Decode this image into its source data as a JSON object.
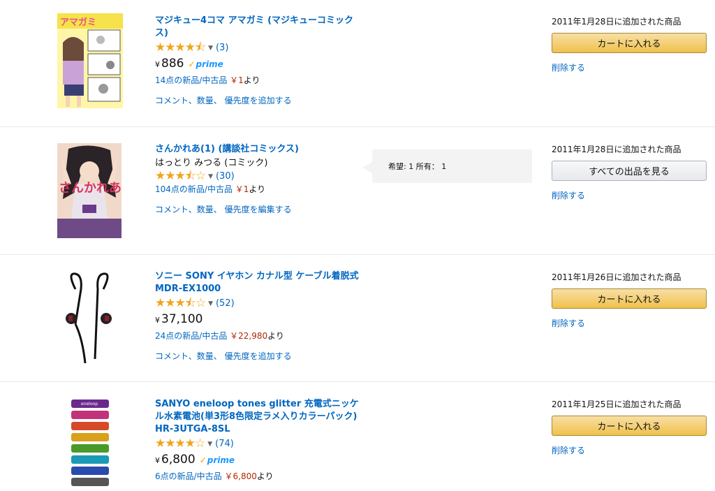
{
  "items": [
    {
      "title": "マジキュー4コマ アマガミ (マジキューコミックス)",
      "author": "",
      "stars": "★★★★⯪",
      "review_count": "(3)",
      "price": "886",
      "yen": "¥",
      "prime": "prime",
      "offers_text": "14点の新品/中古品",
      "offers_price": "￥1",
      "offers_suffix": "より",
      "action_link": "コメント、数量、 優先度を追加する",
      "added": "2011年1月28日に追加された商品",
      "button": "カートに入れる",
      "remove": "削除する"
    },
    {
      "title": "さんかれあ(1) (講談社コミックス)",
      "author": "はっとり みつる (コミック)",
      "stars": "★★★⯪☆",
      "review_count": "(30)",
      "price": "",
      "yen": "",
      "prime": "",
      "offers_text": "104点の新品/中古品",
      "offers_price": "￥1",
      "offers_suffix": "より",
      "action_link": "コメント、数量、 優先度を編集する",
      "added": "2011年1月28日に追加された商品",
      "button": "すべての出品を見る",
      "remove": "削除する",
      "note": "希望: 1 所有： 1"
    },
    {
      "title": "ソニー SONY イヤホン カナル型 ケーブル着脱式 MDR-EX1000",
      "author": "",
      "stars": "★★★⯪☆",
      "review_count": "(52)",
      "price": "37,100",
      "yen": "¥",
      "prime": "",
      "offers_text": "24点の新品/中古品",
      "offers_price": "￥22,980",
      "offers_suffix": "より",
      "action_link": "コメント、数量、 優先度を追加する",
      "added": "2011年1月26日に追加された商品",
      "button": "カートに入れる",
      "remove": "削除する"
    },
    {
      "title": "SANYO eneloop tones glitter 充電式ニッケル水素電池(単3形8色限定ラメ入りカラーパック) HR-3UTGA-8SL",
      "author": "",
      "stars": "★★★★☆",
      "review_count": "(74)",
      "price": "6,800",
      "yen": "¥",
      "prime": "prime",
      "offers_text": "6点の新品/中古品",
      "offers_price": "￥6,800",
      "offers_suffix": "より",
      "action_link": "",
      "added": "2011年1月25日に追加された商品",
      "button": "カートに入れる",
      "remove": "削除する"
    }
  ],
  "thumb_texts": {
    "item0_cover": "アマガミ",
    "item1_cover": "さんかれあ",
    "battery": "eneloop"
  },
  "colors": {
    "link": "#0066c0",
    "star": "#f0a41c",
    "price_red": "#b12704",
    "cart_button": "#f0c14b",
    "prime_blue": "#1a98ff"
  }
}
